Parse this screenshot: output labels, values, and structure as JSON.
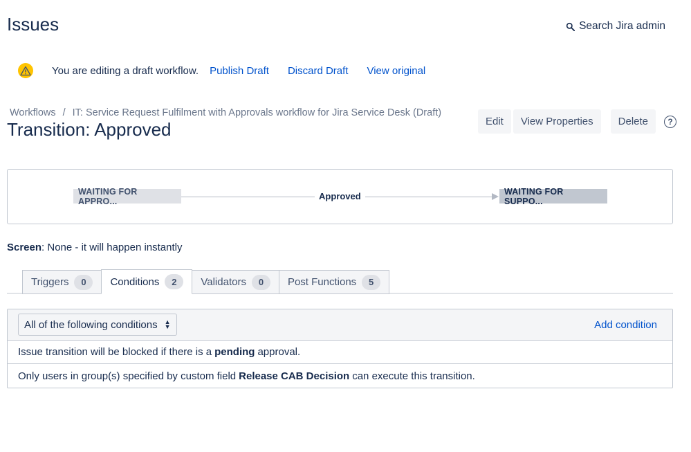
{
  "page": {
    "title": "Issues",
    "search_label": "Search Jira admin"
  },
  "draft_bar": {
    "message": "You are editing a draft workflow.",
    "publish": "Publish Draft",
    "discard": "Discard Draft",
    "view_original": "View original"
  },
  "breadcrumb": {
    "root": "Workflows",
    "separator": "/",
    "workflow": "IT: Service Request Fulfilment with Approvals workflow for Jira Service Desk (Draft)"
  },
  "transition": {
    "title": "Transition: Approved"
  },
  "actions": {
    "edit": "Edit",
    "view_properties": "View Properties",
    "delete": "Delete",
    "help": "?"
  },
  "diagram": {
    "from_status": "WAITING FOR APPRO...",
    "transition_name": "Approved",
    "to_status": "WAITING FOR SUPPO..."
  },
  "screen": {
    "label": "Screen",
    "value": ": None - it will happen instantly"
  },
  "tabs": [
    {
      "label": "Triggers",
      "count": "0"
    },
    {
      "label": "Conditions",
      "count": "2"
    },
    {
      "label": "Validators",
      "count": "0"
    },
    {
      "label": "Post Functions",
      "count": "5"
    }
  ],
  "conditions": {
    "selector_value": "All of the following conditions",
    "add_label": "Add condition",
    "rows": [
      {
        "before": "Issue transition will be blocked if there is a",
        "bold": "pending",
        "after": "approval."
      },
      {
        "before": "Only users in group(s) specified by custom field",
        "bold": "Release CAB Decision",
        "after": "can execute this transition."
      }
    ]
  },
  "icons": {
    "warning": "warning-icon",
    "search": "search-icon",
    "help": "help-icon"
  },
  "colors": {
    "link": "#0052cc",
    "warning": "#ffc400",
    "text": "#172b4d"
  }
}
